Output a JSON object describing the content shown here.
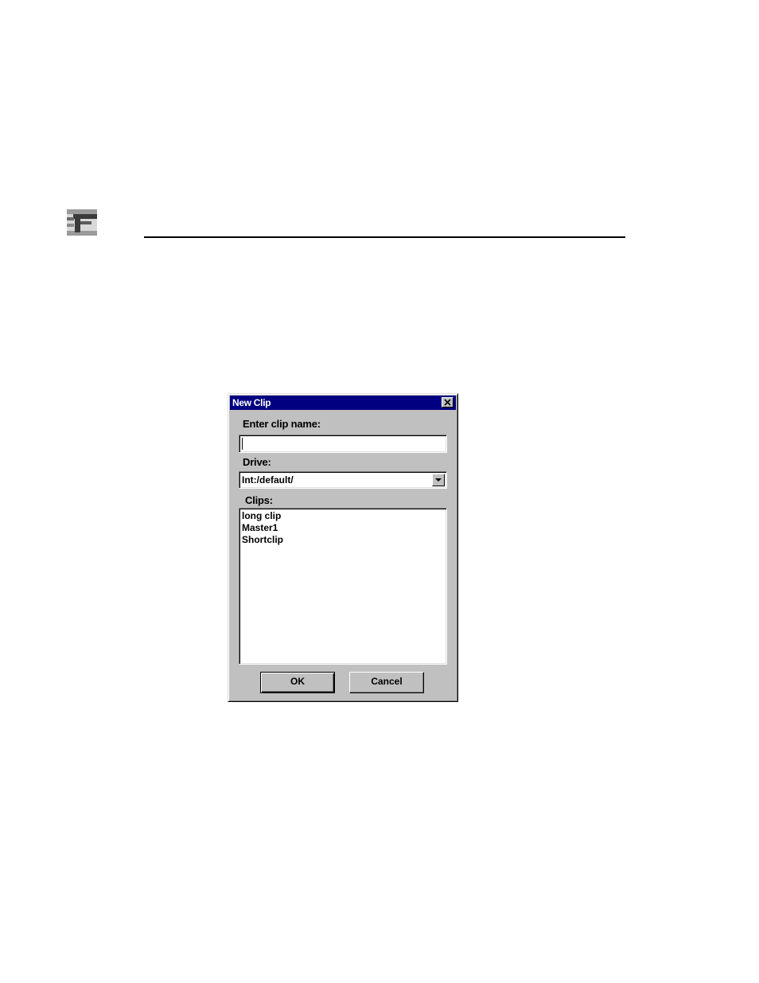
{
  "page": {
    "logo_icon": "company-logo-icon"
  },
  "dialog": {
    "title": "New Clip",
    "close_icon": "close-icon",
    "name_label": "Enter clip name:",
    "name_value": "",
    "drive_label": "Drive:",
    "drive_value": "Int:/default/",
    "clips_label": "Clips:",
    "clips": [
      "long clip",
      "Master1",
      "Shortclip"
    ],
    "ok_mnemonic": "O",
    "ok_rest": "K",
    "cancel_mnemonic": "C",
    "cancel_rest": "ancel"
  },
  "colors": {
    "titlebar": "#000080",
    "face": "#c0c0c0",
    "field": "#ffffff"
  }
}
